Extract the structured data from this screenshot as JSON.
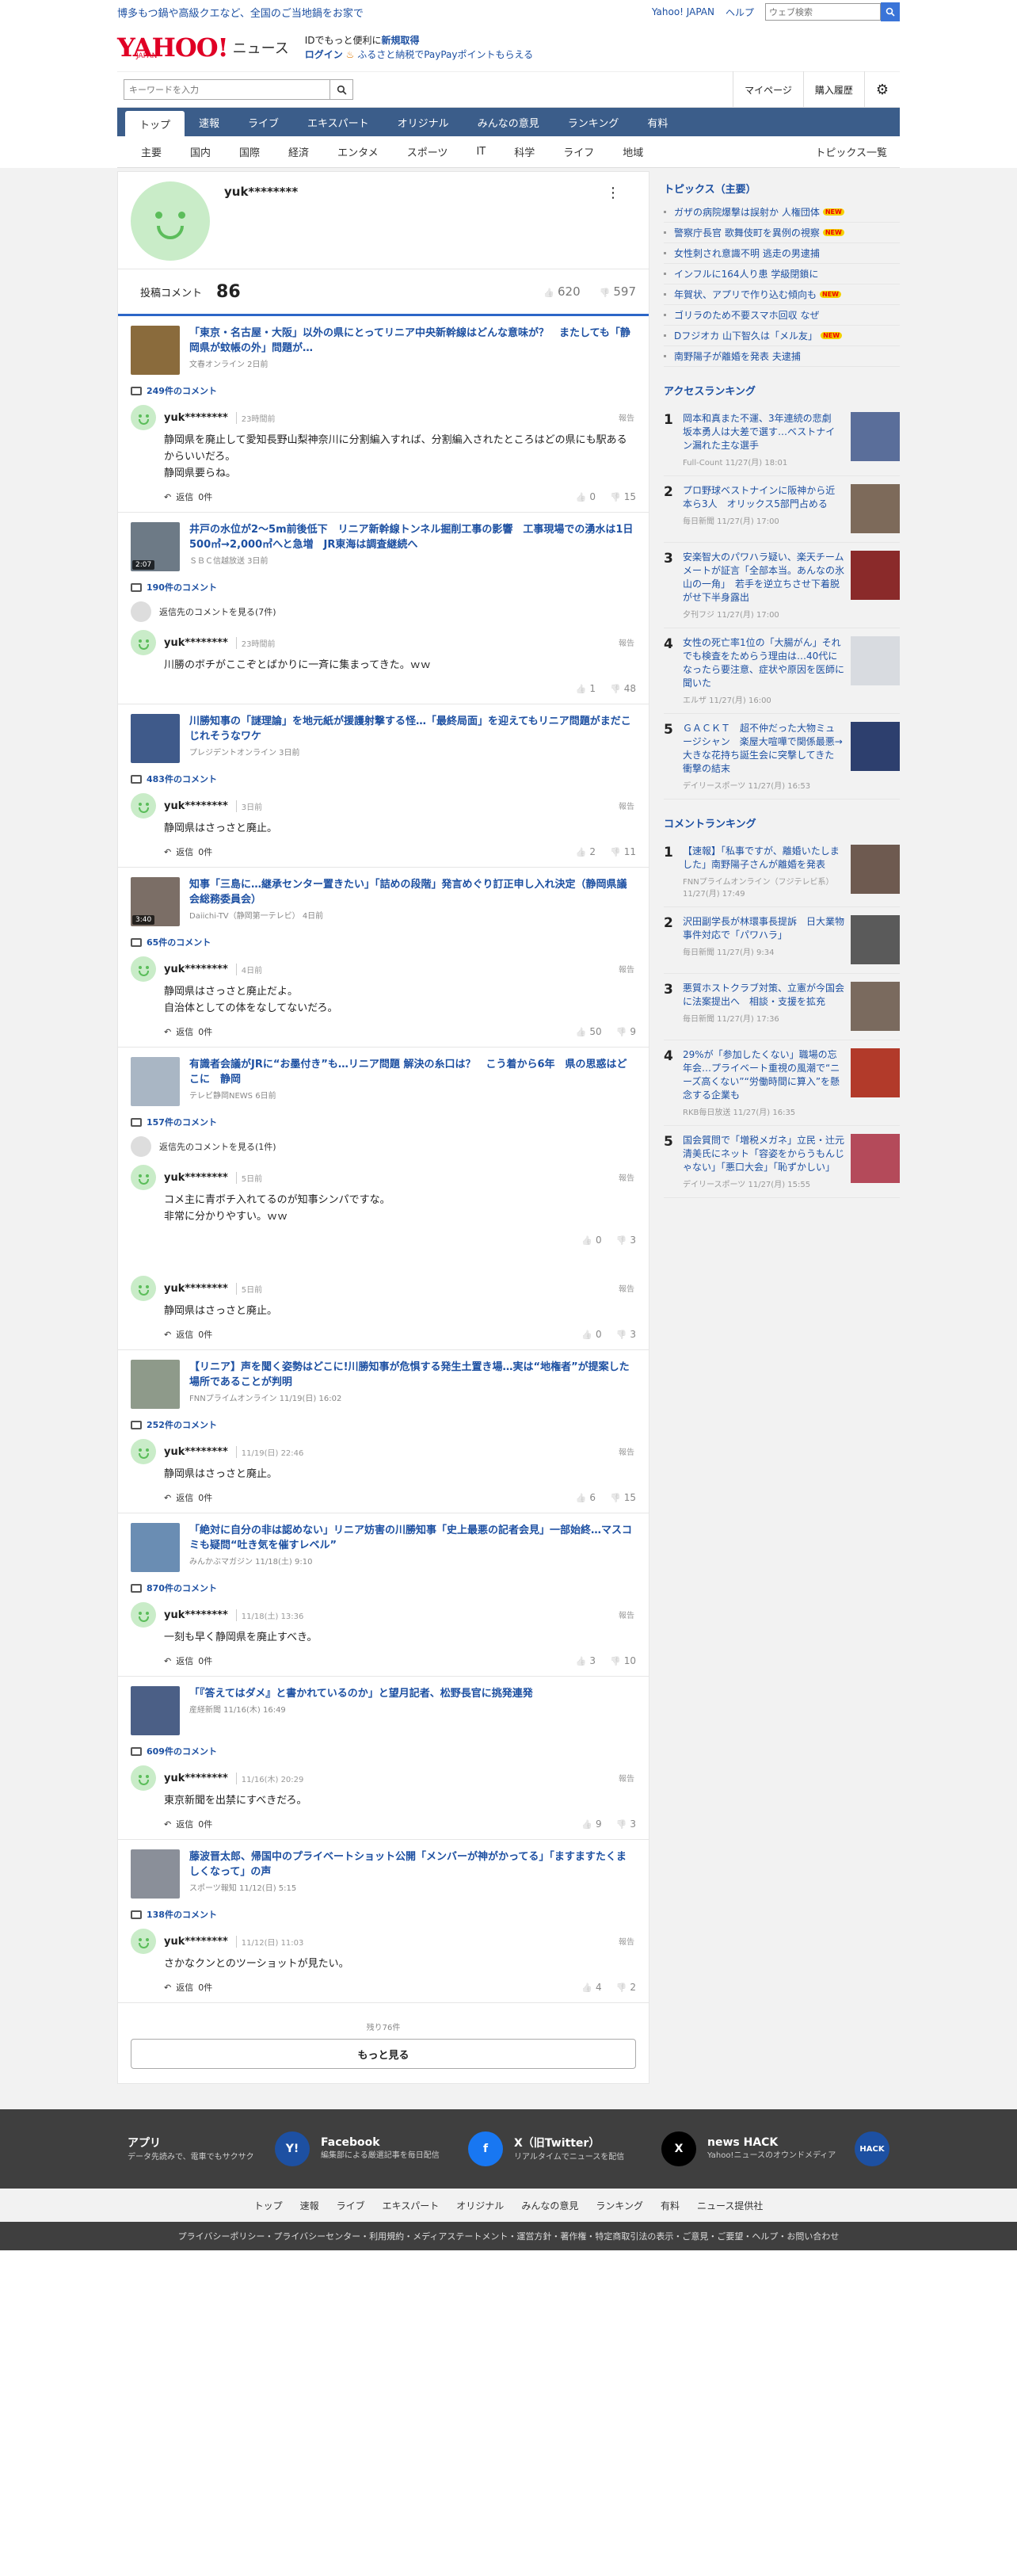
{
  "header": {
    "promo": "博多もつ鍋や高級クエなど、全国のご当地鍋をお家で",
    "yahoo_japan": "Yahoo! JAPAN",
    "help": "ヘルプ",
    "web_search_placeholder": "ウェブ検索",
    "logo_yahoo": "YAHOO!",
    "logo_japan": "JAPAN",
    "logo_news": "ニュース",
    "id_text": "IDでもっと便利に",
    "id_link": "新規取得",
    "login": "ログイン",
    "furusato": "ふるさと納税でPayPayポイントもらえる"
  },
  "search": {
    "placeholder": "キーワードを入力",
    "mypage": "マイページ",
    "history": "購入履歴"
  },
  "nav": {
    "main": [
      "トップ",
      "速報",
      "ライブ",
      "エキスパート",
      "オリジナル",
      "みんなの意見",
      "ランキング",
      "有料"
    ],
    "sub": [
      "主要",
      "国内",
      "国際",
      "経済",
      "エンタメ",
      "スポーツ",
      "IT",
      "科学",
      "ライフ",
      "地域"
    ],
    "all_topics": "トピックス一覧"
  },
  "profile": {
    "username": "yuk********",
    "comments_label": "投稿コメント",
    "comments_count": "86",
    "likes": "620",
    "dislikes": "597"
  },
  "blocks": [
    {
      "title": "「東京・名古屋・大阪」以外の県にとってリニア中央新幹線はどんな意味が？　またしても「静岡県が蚊帳の外」問題が…",
      "source": "文春オンライン 2日前",
      "count": "249件のコメント",
      "hidden": "",
      "thumb": "#8a6b3c",
      "video": "",
      "comments": [
        {
          "user": "yuk********",
          "time": "23時間前",
          "text": "静岡県を廃止して愛知長野山梨神奈川に分割編入すれば、分割編入されたところはどの県にも駅あるからいいだろ。\n静岡県要らね。",
          "reply": "返信",
          "replies": "0件",
          "up": "0",
          "down": "15"
        }
      ]
    },
    {
      "title": "井戸の水位が2～5m前後低下　リニア新幹線トンネル掘削工事の影響　工事現場での湧水は1日500㎥→2,000㎥へと急増　JR東海は調査継続へ",
      "source": "ＳＢＣ信越放送 3日前",
      "count": "190件のコメント",
      "hidden": "返信先のコメントを見る(7件)",
      "thumb": "#6d7a86",
      "video": "2:07",
      "comments": [
        {
          "user": "yuk********",
          "time": "23時間前",
          "text": "川勝のボチがここぞとばかりに一斉に集まってきた。ｗｗ",
          "reply": "",
          "replies": "",
          "up": "1",
          "down": "48"
        }
      ]
    },
    {
      "title": "川勝知事の「謎理論」を地元紙が援護射撃する怪…「最終局面」を迎えてもリニア問題がまだこじれそうなワケ",
      "source": "プレジデントオンライン 3日前",
      "count": "483件のコメント",
      "hidden": "",
      "thumb": "#3f5a8a",
      "video": "",
      "comments": [
        {
          "user": "yuk********",
          "time": "3日前",
          "text": "静岡県はさっさと廃止。",
          "reply": "返信",
          "replies": "0件",
          "up": "2",
          "down": "11"
        }
      ]
    },
    {
      "title": "知事「三島に…継承センター置きたい」「詰めの段階」発言めぐり訂正申し入れ決定（静岡県議会総務委員会）",
      "source": "Daiichi-TV（静岡第一テレビ） 4日前",
      "count": "65件のコメント",
      "hidden": "",
      "thumb": "#7b6e66",
      "video": "3:40",
      "comments": [
        {
          "user": "yuk********",
          "time": "4日前",
          "text": "静岡県はさっさと廃止だよ。\n自治体としての体をなしてないだろ。",
          "reply": "返信",
          "replies": "0件",
          "up": "50",
          "down": "9"
        }
      ]
    },
    {
      "title": "有識者会議がJRに“お墨付き”も…リニア問題 解決の糸口は？　こう着から6年　県の思惑はどこに　静岡",
      "source": "テレビ静岡NEWS 6日前",
      "count": "157件のコメント",
      "hidden": "返信先のコメントを見る(1件)",
      "thumb": "#a9b6c4",
      "video": "",
      "comments": [
        {
          "user": "yuk********",
          "time": "5日前",
          "text": "コメ主に青ボチ入れてるのが知事シンパですな。\n非常に分かりやすい。ｗｗ",
          "reply": "",
          "replies": "",
          "up": "0",
          "down": "3"
        },
        {
          "user": "yuk********",
          "time": "5日前",
          "text": "静岡県はさっさと廃止。",
          "reply": "返信",
          "replies": "0件",
          "up": "0",
          "down": "3"
        }
      ]
    },
    {
      "title": "【リニア】声を聞く姿勢はどこに!川勝知事が危惧する発生土置き場…実は“地権者”が提案した場所であることが判明",
      "source": "FNNプライムオンライン 11/19(日) 16:02",
      "count": "252件のコメント",
      "hidden": "",
      "thumb": "#8e9a8a",
      "video": "",
      "comments": [
        {
          "user": "yuk********",
          "time": "11/19(日) 22:46",
          "text": "静岡県はさっさと廃止。",
          "reply": "返信",
          "replies": "0件",
          "up": "6",
          "down": "15"
        }
      ]
    },
    {
      "title": "「絶対に自分の非は認めない」リニア妨害の川勝知事「史上最悪の記者会見」一部始終…マスコミも疑問“吐き気を催すレベル”",
      "source": "みんかぶマガジン 11/18(土) 9:10",
      "count": "870件のコメント",
      "hidden": "",
      "thumb": "#6a8db3",
      "video": "",
      "comments": [
        {
          "user": "yuk********",
          "time": "11/18(土) 13:36",
          "text": "一刻も早く静岡県を廃止すべき。",
          "reply": "返信",
          "replies": "0件",
          "up": "3",
          "down": "10"
        }
      ]
    },
    {
      "title": "「『答えてはダメ』と書かれているのか」と望月記者、松野長官に挑発連発",
      "source": "産経新聞 11/16(木) 16:49",
      "count": "609件のコメント",
      "hidden": "",
      "thumb": "#4b5f86",
      "video": "",
      "comments": [
        {
          "user": "yuk********",
          "time": "11/16(木) 20:29",
          "text": "東京新聞を出禁にすべきだろ。",
          "reply": "返信",
          "replies": "0件",
          "up": "9",
          "down": "3"
        }
      ]
    },
    {
      "title": "藤波晋太郎、帰国中のプライベートショット公開「メンバーが神がかってる」「ますますたくましくなって」の声",
      "source": "スポーツ報知 11/12(日) 5:15",
      "count": "138件のコメント",
      "hidden": "",
      "thumb": "#8a8f99",
      "video": "",
      "comments": [
        {
          "user": "yuk********",
          "time": "11/12(日) 11:03",
          "text": "さかなクンとのツーショットが見たい。",
          "reply": "返信",
          "replies": "0件",
          "up": "4",
          "down": "2"
        }
      ]
    }
  ],
  "report": "報告",
  "more": {
    "remaining": "残り76件",
    "button": "もっと見る"
  },
  "sidebar": {
    "topics_title": "トピックス（主要）",
    "new_label": "NEW",
    "topics": [
      {
        "t": "ガザの病院爆撃は誤射か 人権団体",
        "n": true
      },
      {
        "t": "警察庁長官 歌舞伎町を異例の視察",
        "n": true
      },
      {
        "t": "女性刺され意識不明 逃走の男逮捕",
        "n": false
      },
      {
        "t": "インフルに164人り患 学級閉鎖に",
        "n": false
      },
      {
        "t": "年賀状、アプリで作り込む傾向も",
        "n": true
      },
      {
        "t": "ゴリラのため不要スマホ回収 なぜ",
        "n": false
      },
      {
        "t": "Dフジオカ 山下智久は「メル友」",
        "n": true
      },
      {
        "t": "南野陽子が離婚を発表 夫逮捕",
        "n": false
      }
    ],
    "access_title": "アクセスランキング",
    "access": [
      {
        "no": "1",
        "t": "岡本和真また不運、3年連続の悲劇　坂本勇人は大差で選す…ベストナイン漏れた主な選手",
        "s": "Full-Count 11/27(月) 18:01",
        "c": "#5a6e9a"
      },
      {
        "no": "2",
        "t": "プロ野球ベストナインに阪神から近本ら3人　オリックス5部門占める",
        "s": "毎日新聞 11/27(月) 17:00",
        "c": "#7d6a5a"
      },
      {
        "no": "3",
        "t": "安楽智大のパワハラ疑い、楽天チームメートが証言「全部本当。あんなの氷山の一角」　若手を逆立ちさせ下着脱がせ下半身露出",
        "s": "夕刊フジ 11/27(月) 17:00",
        "c": "#8a2a2a"
      },
      {
        "no": "4",
        "t": "女性の死亡率1位の「大腸がん」それでも検査をためらう理由は…40代になったら要注意、症状や原因を医師に聞いた",
        "s": "エルザ 11/27(月) 16:00",
        "c": "#d8dbe0"
      },
      {
        "no": "5",
        "t": "ＧＡＣＫＴ　超不仲だった大物ミュージシャン　楽屋大喧嘩で関係最悪→大きな花持ち誕生会に突撃してきた　衝撃の結末",
        "s": "デイリースポーツ 11/27(月) 16:53",
        "c": "#2d3f6e"
      }
    ],
    "comment_title": "コメントランキング",
    "comment": [
      {
        "no": "1",
        "t": "【速報】「私事ですが、離婚いたしました」南野陽子さんが離婚を発表",
        "s": "FNNプライムオンライン（フジテレビ系） 11/27(月) 17:49",
        "c": "#6e5a50"
      },
      {
        "no": "2",
        "t": "沢田副学長が林環事長提訴　日大業物事件対応で「パワハラ」",
        "s": "毎日新聞 11/27(月) 9:34",
        "c": "#5a5a5a"
      },
      {
        "no": "3",
        "t": "悪質ホストクラブ対策、立憲が今国会に法案提出へ　相談・支援を拡充",
        "s": "毎日新聞 11/27(月) 17:36",
        "c": "#7a6a5e"
      },
      {
        "no": "4",
        "t": "29%が「参加したくない」職場の忘年会…プライベート重視の風潮で“ニーズ高くない”“労働時間に算入”を懸念する企業も",
        "s": "RKB毎日放送 11/27(月) 16:35",
        "c": "#b23a2a"
      },
      {
        "no": "5",
        "t": "国会質問で「増税メガネ」立民・辻元清美氏にネット「容姿をからうもんじゃない」「悪口大会」「恥ずかしい」",
        "s": "デイリースポーツ 11/27(月) 15:55",
        "c": "#b44a5a"
      }
    ]
  },
  "footer": {
    "apps": [
      {
        "t": "アプリ",
        "d": "データ先読みで、電車でもサクサク",
        "ic": "Y!",
        "c": "#1d50a2"
      },
      {
        "t": "Facebook",
        "d": "編集部による厳選記事を毎日配信",
        "ic": "f",
        "c": "#1877f2"
      },
      {
        "t": "X（旧Twitter）",
        "d": "リアルタイムでニュースを配信",
        "ic": "X",
        "c": "#000000"
      },
      {
        "t": "news HACK",
        "d": "Yahoo!ニュースのオウンドメディア",
        "ic": "HACK",
        "c": "#1d50a2"
      }
    ],
    "nav": [
      "トップ",
      "速報",
      "ライブ",
      "エキスパート",
      "オリジナル",
      "みんなの意見",
      "ランキング",
      "有料",
      "ニュース提供社"
    ],
    "links": "プライバシーポリシー・プライバシーセンター・利用規約・メディアステートメント・運営方針・著作権・特定商取引法の表示・ご意見・ご要望・ヘルプ・お問い合わせ"
  }
}
